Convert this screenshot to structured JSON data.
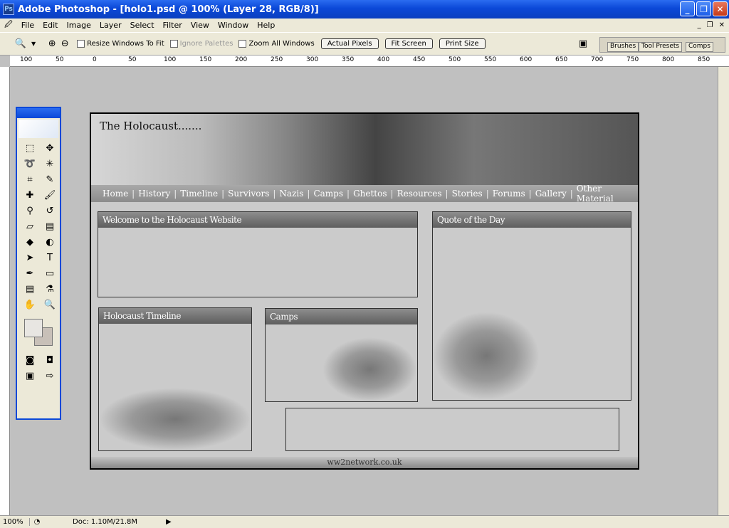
{
  "window": {
    "title": "Adobe Photoshop - [holo1.psd @ 100% (Layer 28, RGB/8)]"
  },
  "menu": [
    "File",
    "Edit",
    "Image",
    "Layer",
    "Select",
    "Filter",
    "View",
    "Window",
    "Help"
  ],
  "options": {
    "resize": "Resize Windows To Fit",
    "ignore": "Ignore Palettes",
    "zoom_all": "Zoom All Windows",
    "actual": "Actual Pixels",
    "fit": "Fit Screen",
    "print": "Print Size"
  },
  "palette_tabs": [
    "Brushes",
    "Tool Presets",
    "Comps"
  ],
  "ruler_labels": [
    "100",
    "50",
    "0",
    "50",
    "100",
    "150",
    "200",
    "250",
    "300",
    "350",
    "400",
    "450",
    "500",
    "550",
    "600",
    "650",
    "700",
    "750",
    "800",
    "850"
  ],
  "status": {
    "zoom": "100%",
    "doc": "Doc: 1.10M/21.8M"
  },
  "site": {
    "title": "The Holocaust.......",
    "nav": [
      "Home",
      "History",
      "Timeline",
      "Survivors",
      "Nazis",
      "Camps",
      "Ghettos",
      "Resources",
      "Stories",
      "Forums",
      "Gallery",
      "Other Material"
    ],
    "welcome": "Welcome to the Holocaust Website",
    "quote": "Quote of the Day",
    "timeline": "Holocaust Timeline",
    "camps": "Camps",
    "footer": "ww2network.co.uk"
  }
}
